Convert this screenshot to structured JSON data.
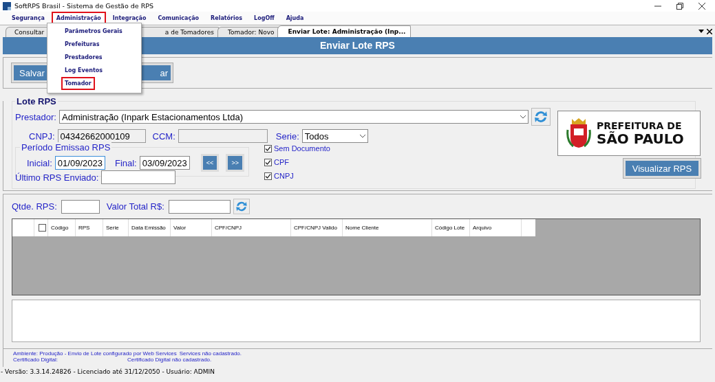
{
  "window": {
    "title": "SoftRPS Brasil - Sistema de Gestão de RPS"
  },
  "menu": [
    {
      "label": "Segurança",
      "selected": false
    },
    {
      "label": "Administração",
      "selected": true
    },
    {
      "label": "Integração",
      "selected": false
    },
    {
      "label": "Comunicação",
      "selected": false
    },
    {
      "label": "Relatórios",
      "selected": false
    },
    {
      "label": "LogOff",
      "selected": false
    },
    {
      "label": "Ajuda",
      "selected": false
    }
  ],
  "dropdown": [
    {
      "label": "Parâmetros Gerais",
      "selected": false
    },
    {
      "label": "Prefeituras",
      "selected": false
    },
    {
      "label": "Prestadores",
      "selected": false
    },
    {
      "label": "Log Eventos",
      "selected": false
    },
    {
      "label": "Tomador",
      "selected": true
    }
  ],
  "tabs": [
    {
      "label": "Consultar",
      "selected": false
    },
    {
      "label": "a de Tomadores",
      "selected": false
    },
    {
      "label": "Tomador: Novo",
      "selected": false
    },
    {
      "label": "Enviar Lote: Administração (Inp...",
      "selected": true
    }
  ],
  "header": "Enviar Lote RPS",
  "toolbar": [
    "Salvar",
    "ar"
  ],
  "lote": {
    "title": "Lote RPS",
    "prestador_label": "Prestador:",
    "prestador": "Administração (Inpark Estacionamentos Ltda)",
    "cnpj_label": "CNPJ:",
    "cnpj": "04342662000109",
    "ccm_label": "CCM:",
    "serie_label": "Serie:",
    "serie": "Todos",
    "periodo_title": "Período Emissao RPS",
    "inicial_label": "Inicial:",
    "inicial": "01/09/2023",
    "final_label": "Final:",
    "final": "03/09/2023",
    "prev": "<<",
    "next": ">>",
    "ultimo_label": "Último RPS Enviado:",
    "filters": [
      {
        "label": "Sem Documento",
        "checked": true
      },
      {
        "label": "CPF",
        "checked": true
      },
      {
        "label": "CNPJ",
        "checked": true
      }
    ],
    "logo_lines": [
      "PREFEITURA DE",
      "SÃO PAULO"
    ],
    "visualizar": "Visualizar RPS"
  },
  "summary": {
    "qtde_label": "Qtde. RPS:",
    "valor_label": "Valor Total R$:"
  },
  "table": {
    "select_all_checked": false,
    "columns": [
      "Código",
      "RPS",
      "Serie",
      "Data Emissão",
      "Valor",
      "CPF/CNPJ",
      "CPF/CNPJ Valido",
      "Nome Cliente",
      "Código Lote",
      "Arquivo"
    ]
  },
  "status_lines": [
    [
      "Ambiente: Produção - Envio de Lote configurado por Web Services",
      "Services não cadastrado."
    ],
    [
      "Certificado Digital:",
      "Certificado Digital não cadastrado."
    ]
  ],
  "footer": "- Versão: 3.3.14.24826 - Licenciado até 31/12/2050 - Usuário: ADMIN"
}
